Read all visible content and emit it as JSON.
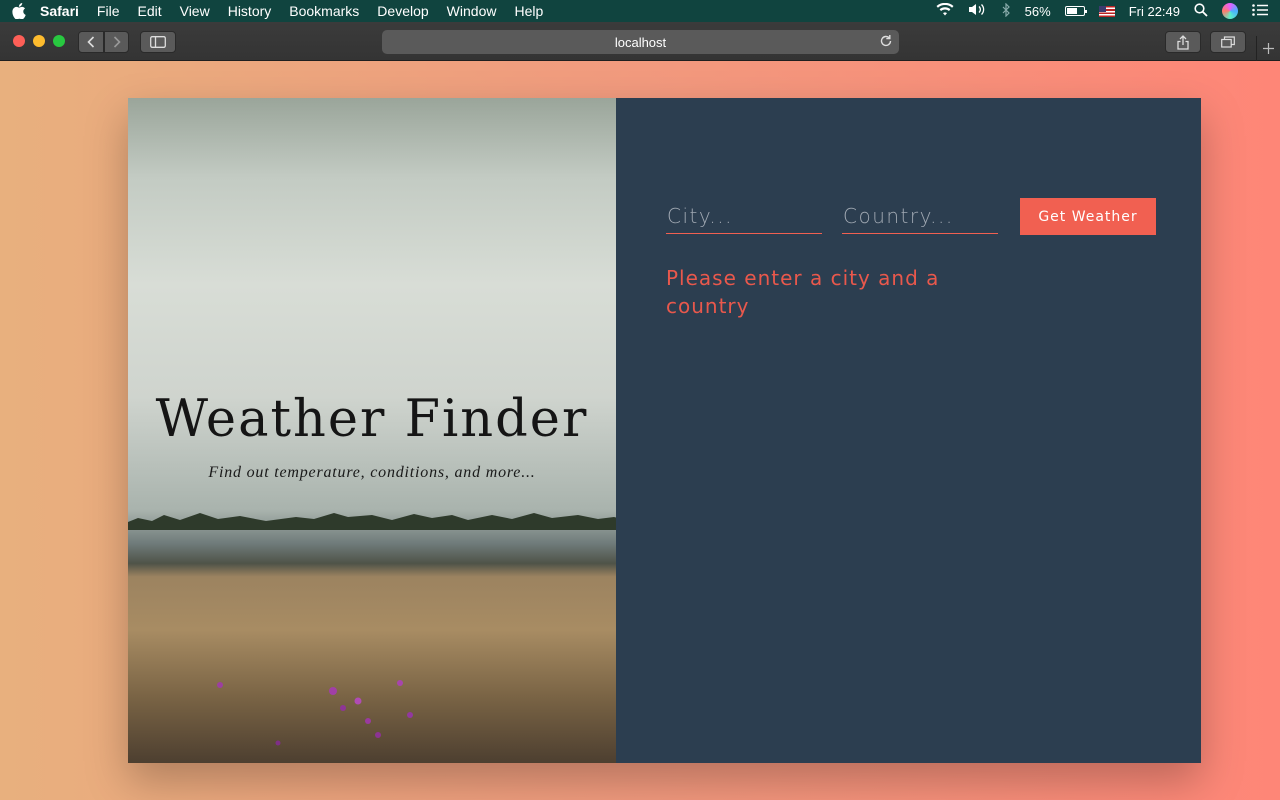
{
  "menubar": {
    "app": "Safari",
    "items": [
      "File",
      "Edit",
      "View",
      "History",
      "Bookmarks",
      "Develop",
      "Window",
      "Help"
    ],
    "battery": "56%",
    "clock": "Fri 22:49"
  },
  "browser": {
    "url": "localhost",
    "icons": [
      "back-icon",
      "forward-icon",
      "sidebar-icon",
      "reload-icon",
      "share-icon",
      "tabs-icon",
      "new-tab-icon"
    ]
  },
  "hero": {
    "title": "Weather Finder",
    "subtitle": "Find out temperature, conditions, and more..."
  },
  "form": {
    "city_placeholder": "City...",
    "country_placeholder": "Country...",
    "button_label": "Get Weather",
    "error_message": "Please enter a city and a country"
  },
  "colors": {
    "panel_bg": "#2c3e50",
    "accent": "#f16051",
    "page_gradient_start": "#e8b07e",
    "page_gradient_end": "#fe8677"
  }
}
